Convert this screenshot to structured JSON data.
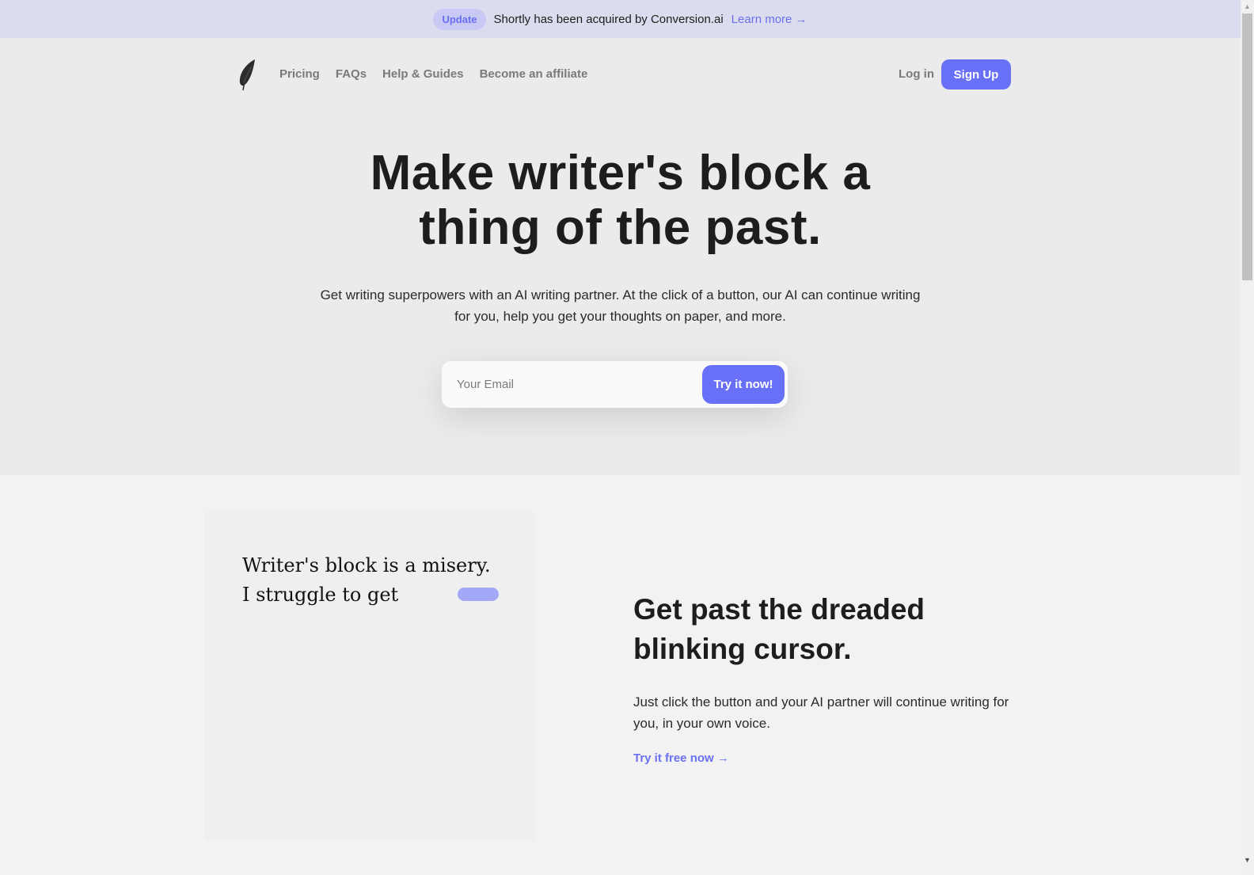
{
  "announcement": {
    "badge": "Update",
    "message": "Shortly has been acquired by Conversion.ai",
    "link": "Learn more →"
  },
  "nav": {
    "logo_icon": "feather-quill-icon",
    "links": [
      "Pricing",
      "FAQs",
      "Help & Guides",
      "Become an affiliate"
    ],
    "login": "Log in",
    "signup": "Sign Up"
  },
  "hero": {
    "headline_line1": "Make writer's block a",
    "headline_line2": "thing of the past.",
    "subhead": "Get writing superpowers with an AI writing partner. At the click of a button, our AI can continue writing for you, help you get your thoughts on paper, and more.",
    "email_placeholder": "Your Email",
    "email_value": "",
    "cta": "Try it now!"
  },
  "feature": {
    "demo_lines": [
      "Writer's block is a misery.",
      "I struggle to get"
    ],
    "title": "Get past the dreaded blinking cursor.",
    "body": "Just click the button and your AI partner will continue writing for you, in your own voice.",
    "link": "Try it free now →"
  },
  "colors": {
    "accent": "#6770f7",
    "announce_bg": "#dcdcef",
    "hero_bg": "#ebebeb",
    "section_bg": "#f2f2f2"
  }
}
